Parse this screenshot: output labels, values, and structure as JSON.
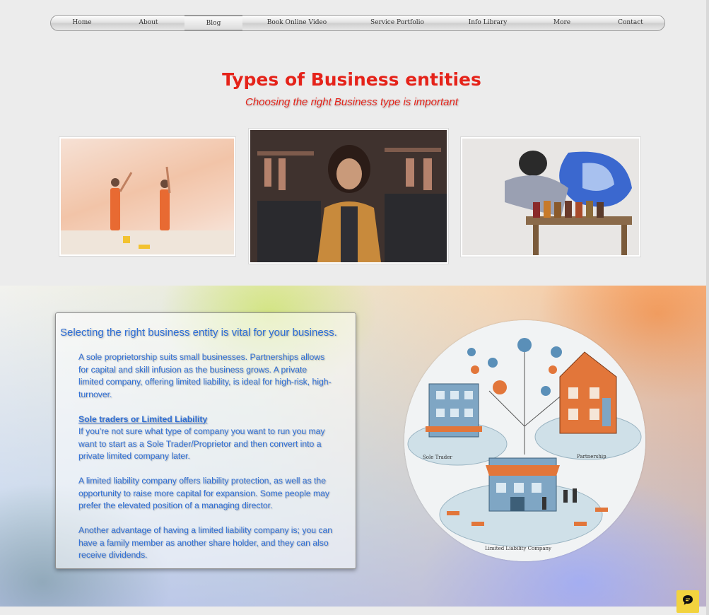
{
  "nav": {
    "items": [
      {
        "label": "Home"
      },
      {
        "label": "About"
      },
      {
        "label": "Blog",
        "active": true
      },
      {
        "label": "Book Online Video"
      },
      {
        "label": "Service Portfolio"
      },
      {
        "label": "Info Library"
      },
      {
        "label": "More"
      },
      {
        "label": "Contact"
      }
    ]
  },
  "hero": {
    "title": "Types of Business entities",
    "subtitle": "Choosing the right Business type is important"
  },
  "card": {
    "title": "Selecting the right business entity is vital for your business.",
    "para1": "A sole proprietorship suits small businesses. Partnerships allows for capital and skill infusion as the business grows. A private limited company, offering limited liability, is ideal for high-risk, high-turnover.",
    "heading": "Sole traders or Limited Liability",
    "para2": "If you're not sure what type of company you want to run you may want to start as a Sole Trader/Proprietor and then convert into a private limited company later.",
    "para3": "A limited liability company offers liability protection, as well as the opportunity to raise more capital for expansion. Some people may prefer the elevated position of a managing director.",
    "para4": "Another advantage of having a limited liability company is; you can have a family member as another share holder, and they can also receive dividends."
  },
  "illustration": {
    "label_sole": "Sole Trader",
    "label_partner": "Partnership",
    "label_ltd": "Limited Liability Company"
  },
  "colors": {
    "accent_red": "#e5231a",
    "text_blue": "#2f6fd6",
    "chat_yellow": "#f2d33f"
  },
  "icons": {
    "chat": "chat-bubble-icon"
  }
}
